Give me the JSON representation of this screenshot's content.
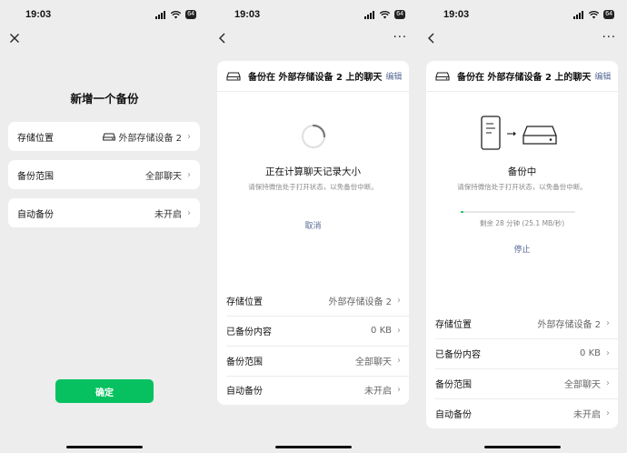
{
  "status_time": "19:03",
  "battery": "64",
  "screen1": {
    "title": "新增一个备份",
    "rows": [
      {
        "label": "存储位置",
        "value": "外部存储设备 2"
      },
      {
        "label": "备份范围",
        "value": "全部聊天"
      },
      {
        "label": "自动备份",
        "value": "未开启"
      }
    ],
    "confirm_label": "确定"
  },
  "screen2": {
    "header_title": "备份在 外部存储设备 2 上的聊天",
    "header_edit": "编辑",
    "status_title": "正在计算聊天记录大小",
    "status_sub": "请保持微信处于打开状态，以免备份中断。",
    "cancel_label": "取消",
    "rows": [
      {
        "label": "存储位置",
        "value": "外部存储设备 2"
      },
      {
        "label": "已备份内容",
        "value": "0 KB"
      },
      {
        "label": "备份范围",
        "value": "全部聊天"
      },
      {
        "label": "自动备份",
        "value": "未开启"
      }
    ]
  },
  "screen3": {
    "header_title": "备份在 外部存储设备 2 上的聊天",
    "header_edit": "编辑",
    "status_title": "备份中",
    "status_sub": "请保持微信处于打开状态，以免备份中断。",
    "progress_fraction": 0.02,
    "remaining_text": "剩余 28 分钟 (25.1 MB/秒)",
    "stop_label": "停止",
    "rows": [
      {
        "label": "存储位置",
        "value": "外部存储设备 2"
      },
      {
        "label": "已备份内容",
        "value": "0 KB"
      },
      {
        "label": "备份范围",
        "value": "全部聊天"
      },
      {
        "label": "自动备份",
        "value": "未开启"
      }
    ]
  },
  "colors": {
    "accent": "#07c160",
    "link": "#576b95",
    "background": "#ededed"
  }
}
